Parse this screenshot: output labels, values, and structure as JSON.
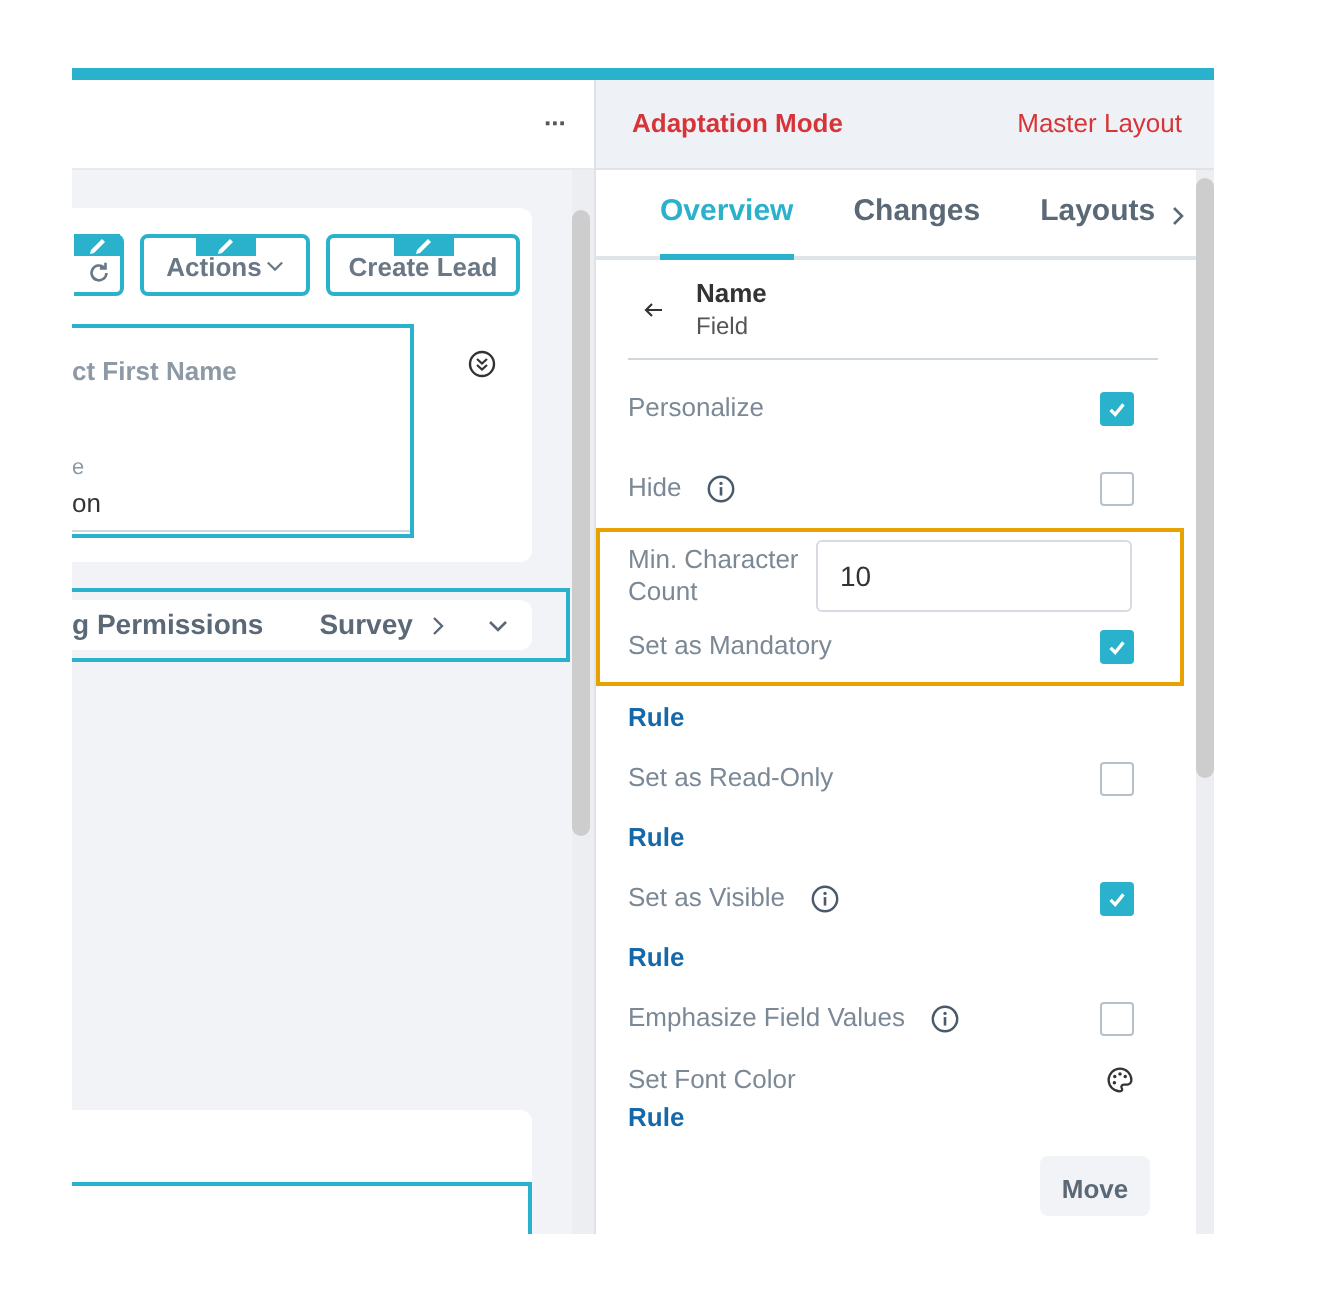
{
  "left_header": {
    "more": "···"
  },
  "toolbar_buttons": [
    {
      "kind": "refresh"
    },
    {
      "kind": "menu",
      "label": "Actions"
    },
    {
      "kind": "plain",
      "label": "Create Lead"
    }
  ],
  "field_card": {
    "title": "ct First Name",
    "label": "e",
    "value": "on"
  },
  "section_tabs": [
    "g Permissions",
    "Survey"
  ],
  "right_header": {
    "mode": "Adaptation Mode",
    "layout": "Master Layout"
  },
  "tabs": [
    {
      "label": "Overview",
      "selected": true
    },
    {
      "label": "Changes",
      "selected": false
    },
    {
      "label": "Layouts",
      "selected": false
    }
  ],
  "back": {
    "title": "Name",
    "subtitle": "Field"
  },
  "properties": [
    {
      "kind": "checkbox",
      "label": "Personalize",
      "info": false,
      "checked": true
    },
    {
      "kind": "checkbox",
      "label": "Hide",
      "info": true,
      "checked": false
    },
    {
      "kind": "group",
      "highlighted": true,
      "children": [
        {
          "kind": "input",
          "label": "Min. Character Count",
          "value": "10"
        },
        {
          "kind": "checkbox",
          "label": "Set as Mandatory",
          "info": false,
          "checked": true
        }
      ]
    },
    {
      "kind": "rule",
      "label": "Rule"
    },
    {
      "kind": "checkbox",
      "label": "Set as Read-Only",
      "info": false,
      "checked": false
    },
    {
      "kind": "rule",
      "label": "Rule"
    },
    {
      "kind": "checkbox",
      "label": "Set as Visible",
      "info": true,
      "checked": true
    },
    {
      "kind": "rule",
      "label": "Rule"
    },
    {
      "kind": "checkbox",
      "label": "Emphasize Field Values",
      "info": true,
      "checked": false
    },
    {
      "kind": "color",
      "label": "Set Font Color",
      "link": "Rule"
    }
  ],
  "move_button": "Move"
}
